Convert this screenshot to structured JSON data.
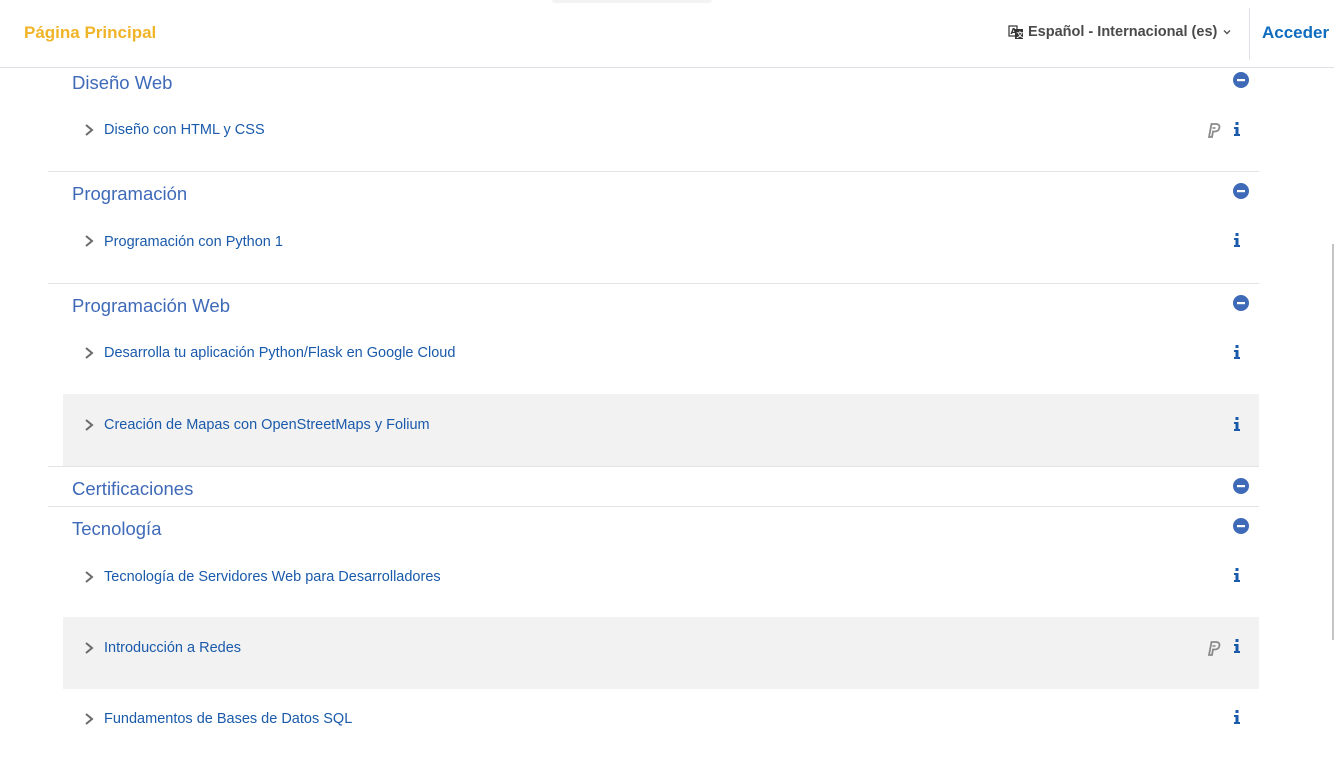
{
  "navbar": {
    "brand": "Página Principal",
    "language": "Español - Internacional (es)",
    "login": "Acceder",
    "language_icon": "language-icon",
    "caret_icon": "chevron-down-icon"
  },
  "colors": {
    "brand": "#f0b429",
    "link": "#1a5aab",
    "category": "#3f6ab8",
    "accent": "#3f6ab8",
    "shaded_row": "#f2f2f2"
  },
  "categories": [
    {
      "title": "Diseño Web",
      "courses": [
        {
          "name": "Diseño con HTML y CSS",
          "paypal": true
        }
      ]
    },
    {
      "title": "Programación",
      "courses": [
        {
          "name": "Programación con Python 1",
          "paypal": false
        }
      ]
    },
    {
      "title": "Programación Web",
      "courses": [
        {
          "name": "Desarrolla tu aplicación Python/Flask en Google Cloud",
          "paypal": false
        },
        {
          "name": "Creación de Mapas con OpenStreetMaps y Folium",
          "paypal": false
        }
      ]
    },
    {
      "title": "Certificaciones",
      "courses": []
    },
    {
      "title": "Tecnología",
      "courses": [
        {
          "name": "Tecnología de Servidores Web para Desarrolladores",
          "paypal": false
        },
        {
          "name": "Introducción a Redes",
          "paypal": true
        },
        {
          "name": "Fundamentos de Bases de Datos SQL",
          "paypal": false
        }
      ]
    }
  ]
}
